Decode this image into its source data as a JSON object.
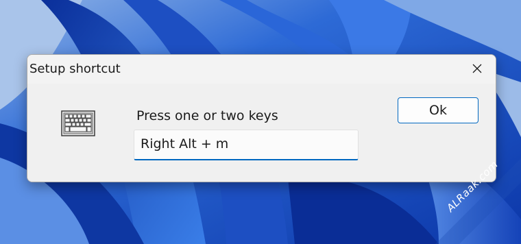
{
  "dialog": {
    "title": "Setup shortcut",
    "prompt": "Press one or two keys",
    "key_value": "Right Alt + m",
    "ok_label": "Ok"
  },
  "icons": {
    "close": "close-icon",
    "keyboard": "keyboard-icon"
  },
  "watermark": "ALRaak.com",
  "colors": {
    "accent": "#0067c0",
    "desktop": "#2f6bd4",
    "dialog_bg": "#f3f3f3"
  }
}
